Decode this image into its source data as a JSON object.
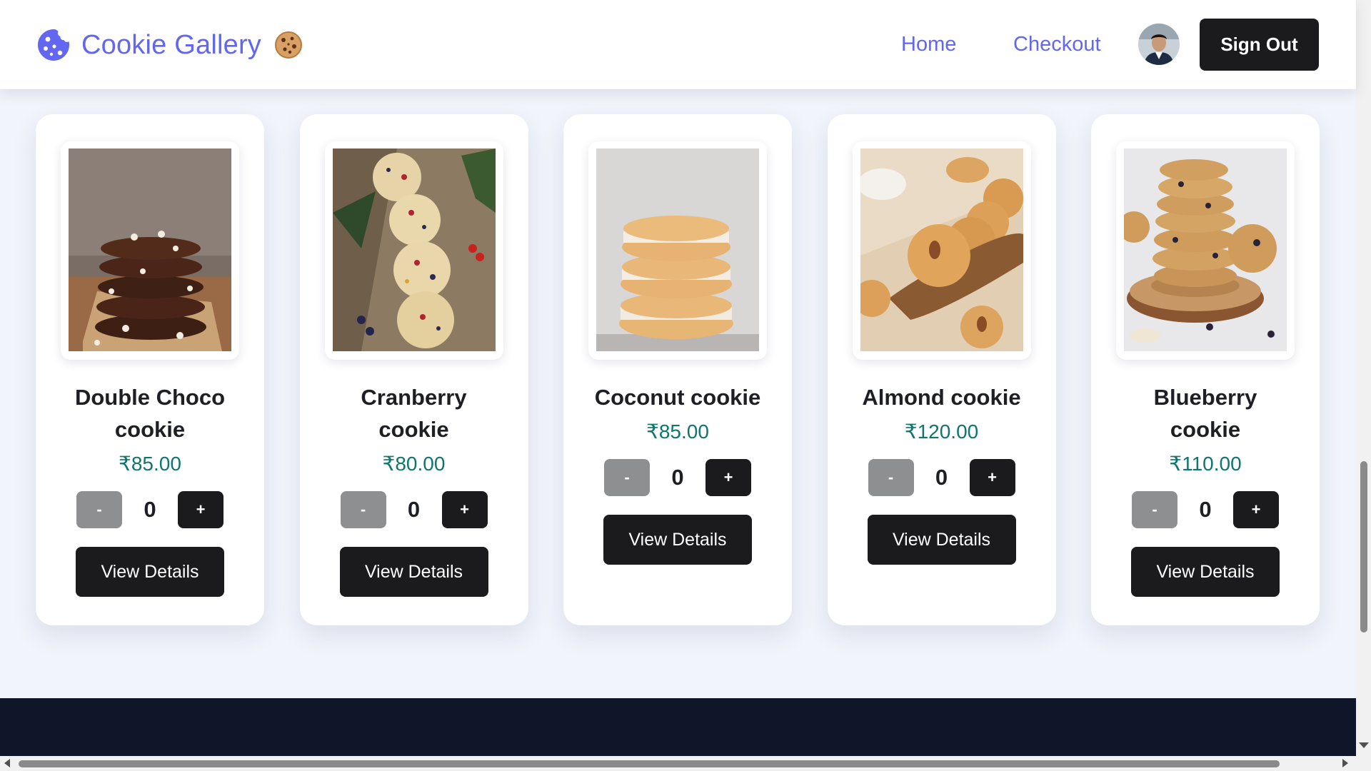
{
  "header": {
    "brand_title": "Cookie Gallery",
    "brand_icon": "cookie-icon",
    "brand_emoji": "cookie-emoji",
    "nav": {
      "home": "Home",
      "checkout": "Checkout"
    },
    "avatar": "user-avatar",
    "signout": "Sign Out"
  },
  "colors": {
    "brand": "#6366f1",
    "price": "#0f766e",
    "button_dark": "#1b1b1d",
    "button_disabled": "#8e8f91",
    "footer": "#0f1629",
    "page_bg": "#f1f4fb"
  },
  "products": [
    {
      "name": "Double Choco cookie",
      "price": "₹85.00",
      "quantity": "0",
      "minus": "-",
      "plus": "+",
      "details": "View Details"
    },
    {
      "name": "Cranberry cookie",
      "price": "₹80.00",
      "quantity": "0",
      "minus": "-",
      "plus": "+",
      "details": "View Details"
    },
    {
      "name": "Coconut cookie",
      "price": "₹85.00",
      "quantity": "0",
      "minus": "-",
      "plus": "+",
      "details": "View Details"
    },
    {
      "name": "Almond cookie",
      "price": "₹120.00",
      "quantity": "0",
      "minus": "-",
      "plus": "+",
      "details": "View Details"
    },
    {
      "name": "Blueberry cookie",
      "price": "₹110.00",
      "quantity": "0",
      "minus": "-",
      "plus": "+",
      "details": "View Details"
    }
  ]
}
